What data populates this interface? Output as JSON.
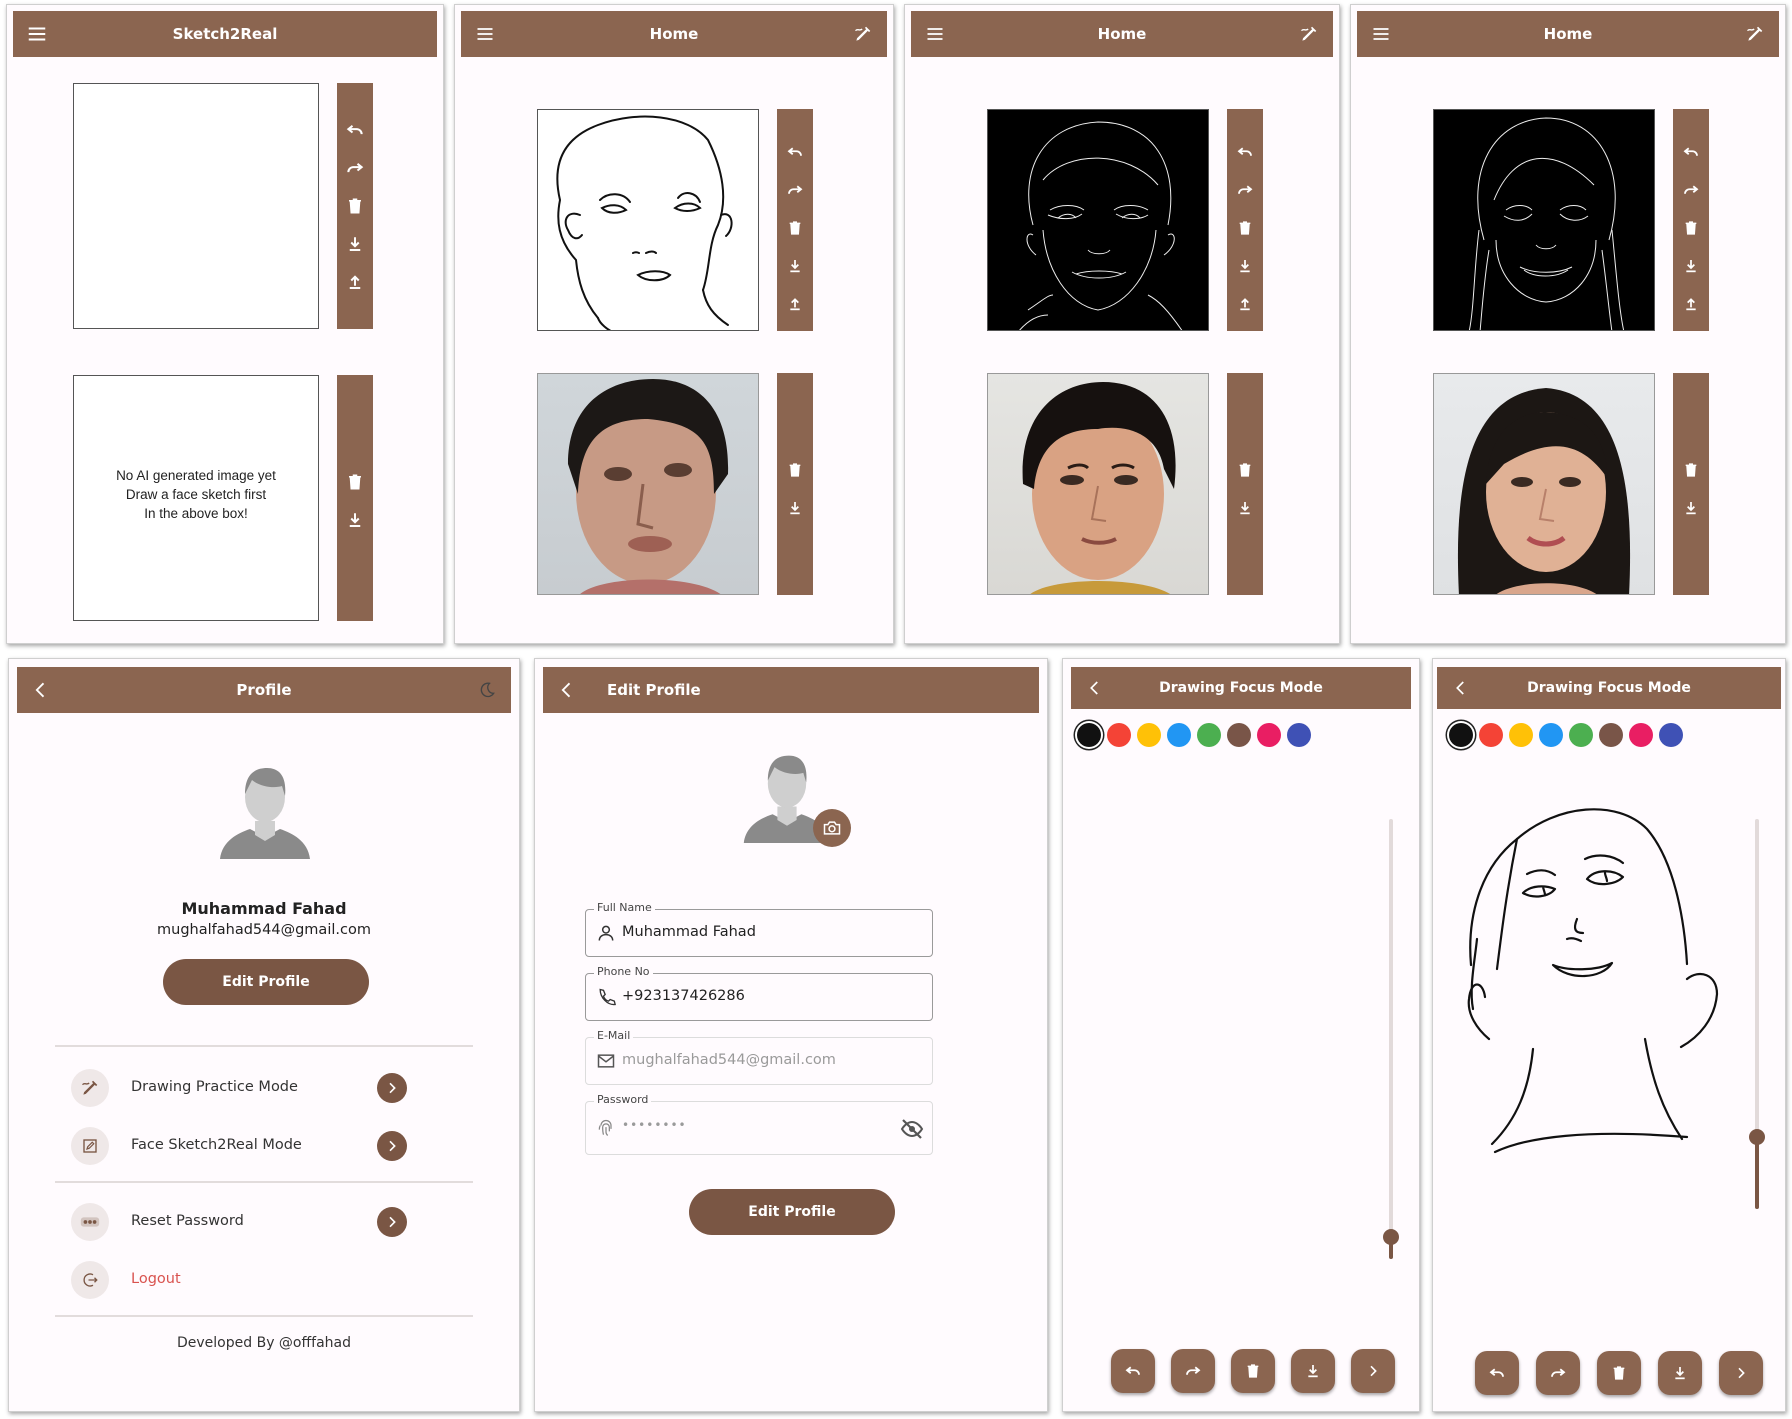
{
  "colors": {
    "brand": "#8b6550",
    "brand_dark": "#7a5644",
    "logout": "#d9534f"
  },
  "screen1": {
    "title": "Sketch2Real",
    "menu_icon": "menu-icon",
    "sketch_tools": [
      "undo-icon",
      "redo-icon",
      "delete-icon",
      "download-icon",
      "upload-icon"
    ],
    "result_tools": [
      "delete-icon",
      "download-icon"
    ],
    "placeholder_lines": [
      "No AI generated image yet",
      "Draw a face sketch first",
      "In the above box!"
    ]
  },
  "screen2": {
    "title": "Home",
    "menu_icon": "menu-icon",
    "action_icon": "draw-icon",
    "sketch_tools": [
      "undo-icon",
      "redo-icon",
      "delete-icon",
      "download-icon",
      "upload-icon"
    ],
    "result_tools": [
      "delete-icon",
      "download-icon"
    ]
  },
  "screen3": {
    "title": "Home",
    "menu_icon": "menu-icon",
    "action_icon": "draw-icon",
    "sketch_tools": [
      "undo-icon",
      "redo-icon",
      "delete-icon",
      "download-icon",
      "upload-icon"
    ],
    "result_tools": [
      "delete-icon",
      "download-icon"
    ]
  },
  "screen4": {
    "title": "Home",
    "menu_icon": "menu-icon",
    "action_icon": "draw-icon",
    "sketch_tools": [
      "undo-icon",
      "redo-icon",
      "delete-icon",
      "download-icon",
      "upload-icon"
    ],
    "result_tools": [
      "delete-icon",
      "download-icon"
    ]
  },
  "profile": {
    "title": "Profile",
    "back_icon": "back-icon",
    "theme_icon": "moon-icon",
    "name": "Muhammad Fahad",
    "email": "mughalfahad544@gmail.com",
    "edit_button": "Edit Profile",
    "menu": [
      {
        "label": "Drawing Practice Mode",
        "icon": "draw-icon"
      },
      {
        "label": "Face Sketch2Real Mode",
        "icon": "edit-square-icon"
      },
      {
        "label": "Reset Password",
        "icon": "password-icon"
      },
      {
        "label": "Logout",
        "icon": "logout-icon"
      }
    ],
    "footer": "Developed By @offfahad"
  },
  "edit_profile": {
    "title": "Edit Profile",
    "back_icon": "back-icon",
    "camera_icon": "camera-icon",
    "fields": [
      {
        "label": "Full Name",
        "value": "Muhammad Fahad",
        "icon": "person-icon"
      },
      {
        "label": "Phone No",
        "value": "+923137426286",
        "icon": "phone-icon"
      },
      {
        "label": "E-Mail",
        "value": "mughalfahad544@gmail.com",
        "icon": "mail-icon"
      },
      {
        "label": "Password",
        "value": "••••••••",
        "icon": "fingerprint-icon"
      }
    ],
    "button": "Edit Profile"
  },
  "drawing1": {
    "title": "Drawing Focus Mode",
    "back_icon": "back-icon",
    "palette": [
      "#111111",
      "#f44336",
      "#ffc107",
      "#2196f3",
      "#4caf50",
      "#795548",
      "#e91e63",
      "#3f51b5"
    ],
    "selected_color": "#111111",
    "stroke_level": 0.05,
    "bottom_buttons": [
      "undo-icon",
      "redo-icon",
      "delete-icon",
      "download-icon",
      "next-icon"
    ]
  },
  "drawing2": {
    "title": "Drawing Focus Mode",
    "back_icon": "back-icon",
    "palette": [
      "#111111",
      "#f44336",
      "#ffc107",
      "#2196f3",
      "#4caf50",
      "#795548",
      "#e91e63",
      "#3f51b5"
    ],
    "selected_color": "#111111",
    "stroke_level": 0.18,
    "bottom_buttons": [
      "undo-icon",
      "redo-icon",
      "delete-icon",
      "download-icon",
      "next-icon"
    ]
  }
}
